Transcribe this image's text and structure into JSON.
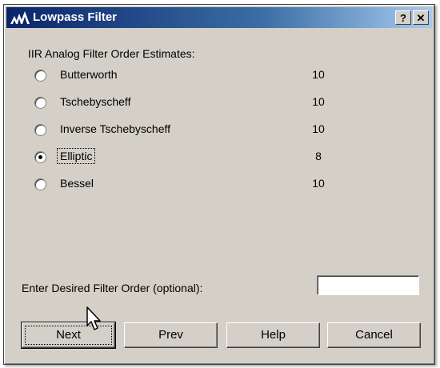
{
  "window": {
    "title": "Lowpass Filter",
    "help_button": "?",
    "close_button": "✕",
    "colors": {
      "titlebar": "#0a246a",
      "dialog_bg": "#d4d0c8"
    }
  },
  "estimates": {
    "label": "IIR Analog Filter Order Estimates:",
    "options": [
      {
        "label": "Butterworth",
        "order": "10",
        "selected": false
      },
      {
        "label": "Tschebyscheff",
        "order": "10",
        "selected": false
      },
      {
        "label": "Inverse Tschebyscheff",
        "order": "10",
        "selected": false
      },
      {
        "label": "Elliptic",
        "order": "8",
        "selected": true
      },
      {
        "label": "Bessel",
        "order": "10",
        "selected": false
      }
    ]
  },
  "desired_order": {
    "label": "Enter Desired Filter Order (optional):",
    "value": ""
  },
  "buttons": {
    "next": "Next",
    "prev": "Prev",
    "help": "Help",
    "cancel": "Cancel"
  }
}
